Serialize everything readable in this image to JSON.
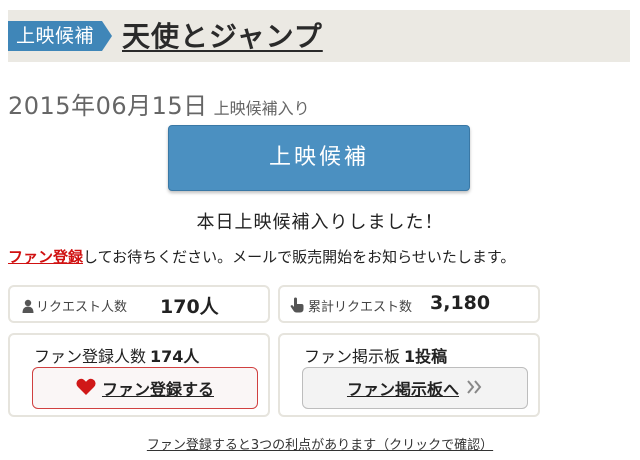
{
  "header": {
    "badge_label": "上映候補",
    "movie_title": "天使とジャンプ"
  },
  "status": {
    "date": "2015年06月15日",
    "date_suffix": "上映候補入り",
    "button_label": "上映候補",
    "added_message": "本日上映候補入りしました！"
  },
  "notice": {
    "link_text": "ファン登録",
    "text": "してお待ちください。メールで販売開始をお知らせいたします。"
  },
  "stats": {
    "requests_label": "リクエスト人数",
    "requests_value": "170人",
    "cumulative_label": "累計リクエスト数",
    "cumulative_value": "3,180"
  },
  "fan": {
    "count_label": "ファン登録人数",
    "count_value": "174人",
    "register_button": "ファン登録する"
  },
  "board": {
    "label": "ファン掲示板",
    "posts_value": "1投稿",
    "button_label": "ファン掲示板へ"
  },
  "footer": {
    "link_text": "ファン登録すると3つの利点があります（クリックで確認）"
  },
  "colors": {
    "accent_blue": "#4b90c1",
    "link_red": "#d01010",
    "header_bg": "#ebe9e3"
  },
  "icons": [
    "user-icon",
    "pointer-hand-icon",
    "heart-icon",
    "double-chevron-right-icon"
  ]
}
